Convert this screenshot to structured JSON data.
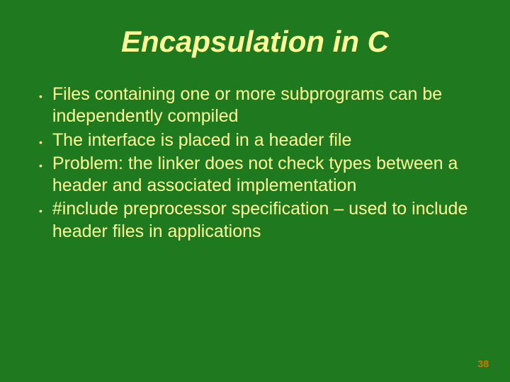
{
  "title": "Encapsulation in C",
  "bullets": [
    "Files containing one or more subprograms can be independently compiled",
    "The interface is placed in a header file",
    "Problem: the linker does not check types between a header and associated implementation",
    "#include preprocessor specification – used to include header files in applications"
  ],
  "pageNumber": "38"
}
